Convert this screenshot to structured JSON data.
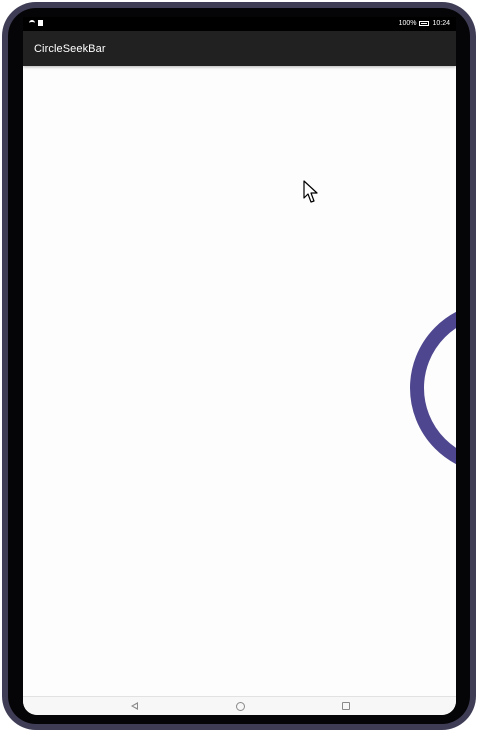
{
  "status_bar": {
    "battery_percent": "100%",
    "time": "10:24",
    "icons": [
      "wifi-icon",
      "sim-icon",
      "battery-icon"
    ]
  },
  "app_bar": {
    "title": "CircleSeekBar"
  },
  "circle_seekbar": {
    "color": "#4e478f"
  },
  "nav_bar": {
    "buttons": [
      "back-icon",
      "home-icon",
      "recent-apps-icon"
    ]
  },
  "colors": {
    "device_frame": "#3e3d55",
    "app_bar": "#212121",
    "screen_background": "#fdfdfd"
  }
}
